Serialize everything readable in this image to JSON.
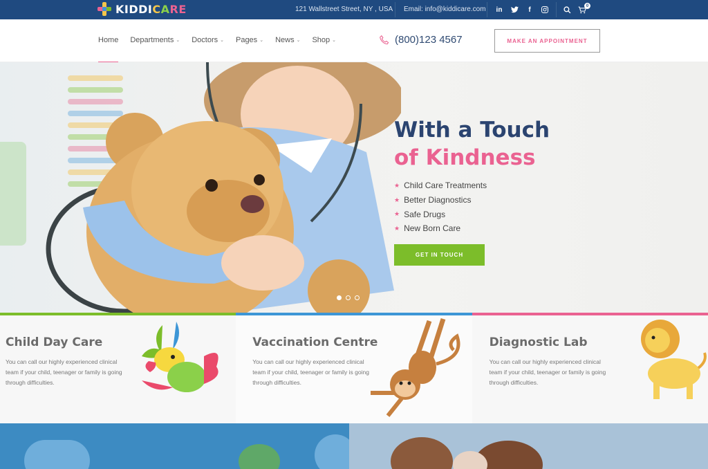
{
  "brand": {
    "name": "KIDDICARE",
    "name_parts": [
      "KIDDI",
      "C",
      "A",
      "RE"
    ]
  },
  "topbar": {
    "address": "121 Wallstreet Street, NY , USA",
    "email_label": "Email: ",
    "email": "info@kiddicare.com",
    "social": [
      {
        "icon": "linkedin-icon",
        "glyph": "in"
      },
      {
        "icon": "twitter-icon",
        "glyph": "🐦"
      },
      {
        "icon": "facebook-icon",
        "glyph": "f"
      },
      {
        "icon": "instagram-icon",
        "glyph": "◎"
      }
    ],
    "cart_count": "0"
  },
  "nav": {
    "items": [
      {
        "label": "Home",
        "dropdown": false
      },
      {
        "label": "Departments",
        "dropdown": true
      },
      {
        "label": "Doctors",
        "dropdown": true
      },
      {
        "label": "Pages",
        "dropdown": true
      },
      {
        "label": "News",
        "dropdown": true
      },
      {
        "label": "Shop",
        "dropdown": true
      }
    ],
    "phone": "(800)123 4567",
    "appointment_label": "MAKE AN APPOINTMENT"
  },
  "hero": {
    "title_line1": "With a Touch",
    "title_line2": "of Kindness",
    "list": [
      "Child Care Treatments",
      "Better Diagnostics",
      "Safe Drugs",
      "New Born Care"
    ],
    "cta_label": "GET IN TOUCH",
    "slides": 3,
    "active_slide": 1
  },
  "features": [
    {
      "title": "Child Day Care",
      "text": "You can call our highly experienced clinical team if your child, teenager or family is going through difficulties.",
      "color": "#7cbd2a",
      "icon": "parrot-icon"
    },
    {
      "title": "Vaccination Centre",
      "text": "You can call our highly experienced clinical team if your child, teenager or family is going through difficulties.",
      "color": "#3d96d6",
      "icon": "monkey-icon"
    },
    {
      "title": "Diagnostic Lab",
      "text": "You can call our highly experienced clinical team if your child, teenager or family is going through difficulties.",
      "color": "#ea6291",
      "icon": "lion-icon"
    }
  ],
  "colors": {
    "topbar": "#1f4a80",
    "accent_pink": "#ea6291",
    "accent_green": "#7cbd2a",
    "accent_blue": "#3d96d6",
    "heading_navy": "#2b4470"
  }
}
